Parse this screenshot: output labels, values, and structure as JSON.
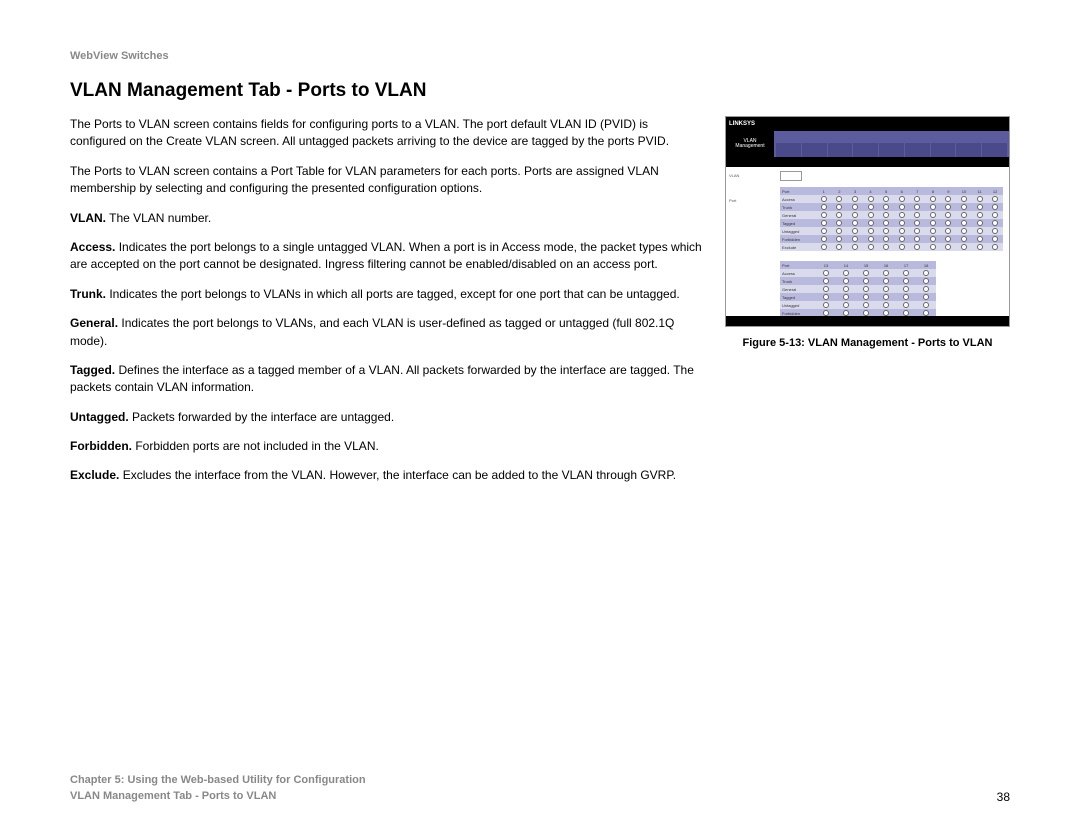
{
  "header": "WebView Switches",
  "heading": "VLAN Management Tab - Ports to VLAN",
  "intro1": "The Ports to VLAN screen contains fields for configuring ports to a VLAN. The port default VLAN ID (PVID) is configured on the Create VLAN screen. All untagged packets arriving to the device are tagged by the ports PVID.",
  "intro2": "The Ports to VLAN screen contains a Port Table for VLAN parameters for each ports. Ports are assigned VLAN membership by selecting and configuring the presented configuration options.",
  "defs": [
    {
      "term": "VLAN.",
      "text": " The VLAN number."
    },
    {
      "term": "Access.",
      "text": " Indicates the port belongs to a single untagged VLAN. When a port is in Access mode, the packet types which are accepted on the port cannot be designated. Ingress filtering cannot be enabled/disabled on an access port."
    },
    {
      "term": "Trunk.",
      "text": " Indicates the port belongs to VLANs in which all ports are tagged, except for one port that can be untagged."
    },
    {
      "term": "General.",
      "text": " Indicates the port belongs to VLANs, and each VLAN is user-defined as tagged or untagged (full 802.1Q mode)."
    },
    {
      "term": "Tagged.",
      "text": " Defines the interface as a tagged member of a VLAN. All packets forwarded by the interface are tagged. The packets contain VLAN information."
    },
    {
      "term": "Untagged.",
      "text": " Packets forwarded by the interface are untagged."
    },
    {
      "term": "Forbidden.",
      "text": " Forbidden ports are not included in the VLAN."
    },
    {
      "term": "Exclude.",
      "text": " Excludes the interface from the VLAN. However, the interface can be added to the VLAN through GVRP."
    }
  ],
  "screenshot": {
    "brand": "LINKSYS",
    "sideTitle1": "VLAN",
    "sideTitle2": "Management",
    "rows": [
      "Access",
      "Trunk",
      "General",
      "Tagged",
      "Untagged",
      "Forbidden",
      "Exclude"
    ],
    "portsLabel": "Port",
    "vlanLabel": "VLAN"
  },
  "figureCaption": "Figure 5-13: VLAN Management - Ports to VLAN",
  "footer": {
    "chapter": "Chapter 5: Using the Web-based Utility for Configuration",
    "section": "VLAN Management Tab - Ports to VLAN",
    "page": "38"
  }
}
